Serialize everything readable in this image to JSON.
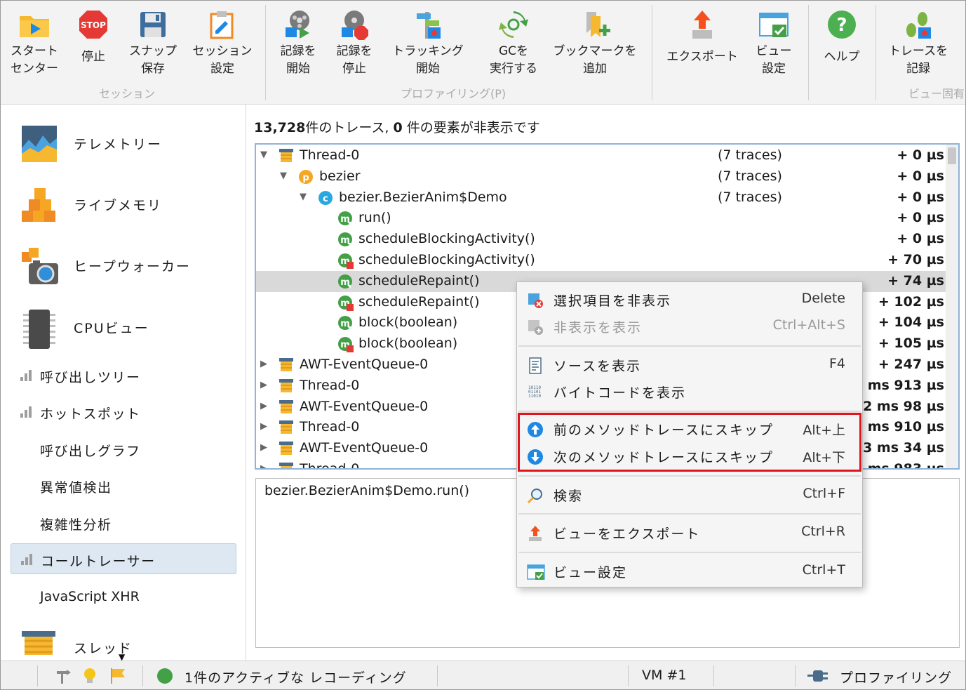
{
  "toolbar": {
    "buttons": [
      {
        "label": "スタート\nセンター",
        "icon": "start-center-icon"
      },
      {
        "label": "停止",
        "icon": "stop-icon"
      },
      {
        "label": "スナップ\n保存",
        "icon": "save-snapshot-icon"
      },
      {
        "label": "セッション\n設定",
        "icon": "session-settings-icon"
      },
      {
        "label": "記録を\n開始",
        "icon": "start-recording-icon"
      },
      {
        "label": "記録を\n停止",
        "icon": "stop-recording-icon"
      },
      {
        "label": "トラッキング\n開始",
        "icon": "start-tracking-icon"
      },
      {
        "label": "GCを\n実行する",
        "icon": "run-gc-icon"
      },
      {
        "label": "ブックマークを\n追加",
        "icon": "add-bookmark-icon"
      },
      {
        "label": "エクスポート",
        "icon": "export-icon"
      },
      {
        "label": "ビュー\n設定",
        "icon": "view-settings-icon"
      },
      {
        "label": "ヘルプ",
        "icon": "help-icon"
      },
      {
        "label": "トレースを\n記録",
        "icon": "record-traces-icon"
      }
    ],
    "groups": {
      "session": "セッション",
      "profiling": "プロファイリング(P)",
      "view": "ビュー固有"
    }
  },
  "sidebar": {
    "big_items": [
      {
        "label": "テレメトリー",
        "icon": "telemetry-icon"
      },
      {
        "label": "ライブメモリ",
        "icon": "live-memory-icon"
      },
      {
        "label": "ヒープウォーカー",
        "icon": "heap-walker-icon"
      },
      {
        "label": "CPUビュー",
        "icon": "cpu-views-icon"
      }
    ],
    "small_items": [
      {
        "label": "呼び出しツリー",
        "icon": true,
        "active": false
      },
      {
        "label": "ホットスポット",
        "icon": true,
        "active": false
      },
      {
        "label": "呼び出しグラフ",
        "icon": false,
        "active": false
      },
      {
        "label": "異常値検出",
        "icon": false,
        "active": false
      },
      {
        "label": "複雑性分析",
        "icon": false,
        "active": false
      },
      {
        "label": "コールトレーサー",
        "icon": true,
        "active": true
      },
      {
        "label": "JavaScript XHR",
        "icon": false,
        "active": false
      }
    ],
    "bottom_item": {
      "label": "スレッド",
      "icon": "threads-icon"
    }
  },
  "summary": {
    "count": "13,728",
    "text1": "件のトレース, ",
    "hidden": "0",
    "text2": " 件の要素が非表示です"
  },
  "tree": {
    "rows": [
      {
        "indent": 0,
        "arrow": "down",
        "icon": "thread",
        "name": "Thread-0",
        "traces": "(7 traces)",
        "time": "+ 0 µs"
      },
      {
        "indent": 1,
        "arrow": "down",
        "icon": "package",
        "name": "bezier",
        "traces": "(7 traces)",
        "time": "+ 0 µs"
      },
      {
        "indent": 2,
        "arrow": "down",
        "icon": "class",
        "name": "bezier.BezierAnim$Demo",
        "traces": "(7 traces)",
        "time": "+ 0 µs"
      },
      {
        "indent": 3,
        "arrow": "",
        "icon": "method",
        "name": "run()",
        "traces": "",
        "time": "+ 0 µs"
      },
      {
        "indent": 3,
        "arrow": "",
        "icon": "method",
        "name": "scheduleBlockingActivity()",
        "traces": "",
        "time": "+ 0 µs"
      },
      {
        "indent": 3,
        "arrow": "",
        "icon": "method-exit",
        "name": "scheduleBlockingActivity()",
        "traces": "",
        "time": "+ 70 µs"
      },
      {
        "indent": 3,
        "arrow": "",
        "icon": "method",
        "name": "scheduleRepaint()",
        "traces": "",
        "time": "+ 74 µs",
        "selected": true
      },
      {
        "indent": 3,
        "arrow": "",
        "icon": "method-exit",
        "name": "scheduleRepaint()",
        "traces": "",
        "time": "+ 102 µs"
      },
      {
        "indent": 3,
        "arrow": "",
        "icon": "method",
        "name": "block(boolean)",
        "traces": "",
        "time": "+ 104 µs"
      },
      {
        "indent": 3,
        "arrow": "",
        "icon": "method-exit",
        "name": "block(boolean)",
        "traces": "",
        "time": "+ 105 µs"
      },
      {
        "indent": 0,
        "arrow": "right",
        "icon": "thread",
        "name": "AWT-EventQueue-0",
        "traces": "",
        "time": "+ 247 µs"
      },
      {
        "indent": 0,
        "arrow": "right",
        "icon": "thread",
        "name": "Thread-0",
        "traces": "",
        "time": "+ 1 ms 913 µs"
      },
      {
        "indent": 0,
        "arrow": "right",
        "icon": "thread",
        "name": "AWT-EventQueue-0",
        "traces": "",
        "time": "+ 12 ms 98 µs"
      },
      {
        "indent": 0,
        "arrow": "right",
        "icon": "thread",
        "name": "Thread-0",
        "traces": "",
        "time": "+ 12 ms 910 µs"
      },
      {
        "indent": 0,
        "arrow": "right",
        "icon": "thread",
        "name": "AWT-EventQueue-0",
        "traces": "",
        "time": "+ 23 ms 34 µs"
      },
      {
        "indent": 0,
        "arrow": "right",
        "icon": "thread",
        "name": "Thread-0",
        "traces": "",
        "time": "+ 23 ms 983 µs"
      }
    ]
  },
  "detail": {
    "text": "bezier.BezierAnim$Demo.run()"
  },
  "context_menu": {
    "items": [
      {
        "label": "選択項目を非表示",
        "shortcut": "Delete",
        "icon": "hide-selected-icon",
        "disabled": false
      },
      {
        "label": "非表示を表示",
        "shortcut": "Ctrl+Alt+S",
        "icon": "show-hidden-icon",
        "disabled": true
      },
      {
        "label": "ソースを表示",
        "shortcut": "F4",
        "icon": "show-source-icon",
        "disabled": false
      },
      {
        "label": "バイトコードを表示",
        "shortcut": "",
        "icon": "show-bytecode-icon",
        "disabled": false
      },
      {
        "label": "前のメソッドトレースにスキップ",
        "shortcut": "Alt+上",
        "icon": "skip-previous-icon",
        "disabled": false
      },
      {
        "label": "次のメソッドトレースにスキップ",
        "shortcut": "Alt+下",
        "icon": "skip-next-icon",
        "disabled": false
      },
      {
        "label": "検索",
        "shortcut": "Ctrl+F",
        "icon": "search-icon",
        "disabled": false
      },
      {
        "label": "ビューをエクスポート",
        "shortcut": "Ctrl+R",
        "icon": "export-view-icon",
        "disabled": false
      },
      {
        "label": "ビュー設定",
        "shortcut": "Ctrl+T",
        "icon": "view-settings-icon",
        "disabled": false
      }
    ]
  },
  "status": {
    "recording": "1件のアクティブな レコーディング",
    "vm": "VM #1",
    "mode": "プロファイリング"
  },
  "colors": {
    "accent": "#2f8fd8",
    "highlight": "#e0141b",
    "selected_row": "#d9d9d9",
    "active_nav": "#dde8f3"
  }
}
